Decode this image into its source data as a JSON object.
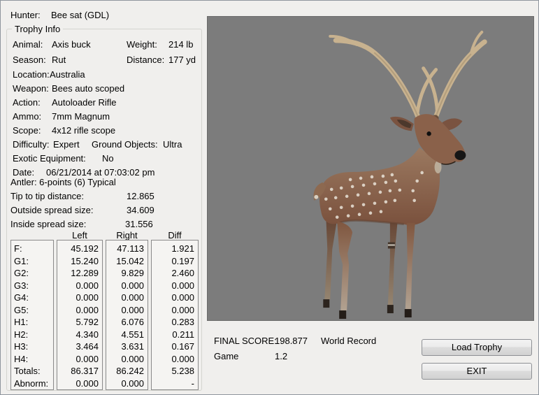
{
  "hunter": {
    "label": "Hunter:",
    "value": "Bee sat (GDL)"
  },
  "trophy_info": {
    "title": "Trophy Info",
    "animal": {
      "label": "Animal:",
      "value": "Axis buck"
    },
    "weight": {
      "label": "Weight:",
      "value": "214 lb"
    },
    "season": {
      "label": "Season:",
      "value": "Rut"
    },
    "distance": {
      "label": "Distance:",
      "value": "177 yd"
    },
    "location": {
      "label": "Location:",
      "value": "Australia"
    },
    "weapon": {
      "label": "Weapon:",
      "value": "Bees auto scoped"
    },
    "action": {
      "label": "Action:",
      "value": "Autoloader Rifle"
    },
    "ammo": {
      "label": "Ammo:",
      "value": "7mm Magnum"
    },
    "scope": {
      "label": "Scope:",
      "value": "4x12 rifle scope"
    },
    "difficulty": {
      "label": "Difficulty:",
      "value": "Expert"
    },
    "ground_objects": {
      "label": "Ground Objects:",
      "value": "Ultra"
    },
    "exotic_equipment": {
      "label": "Exotic Equipment:",
      "value": "No"
    },
    "date": {
      "label": "Date:",
      "value": "06/21/2014 at 07:03:02 pm"
    }
  },
  "antler": {
    "summary": "Antler: 6-points (6) Typical",
    "tip_to_tip": {
      "label": "Tip to tip distance:",
      "value": "12.865"
    },
    "outside_spread": {
      "label": "Outside spread size:",
      "value": "34.609"
    },
    "inside_spread": {
      "label": "Inside spread size:",
      "value": "31.556"
    }
  },
  "measurements": {
    "headers": {
      "left": "Left",
      "right": "Right",
      "diff": "Diff"
    },
    "rows": [
      {
        "label": "F:",
        "left": "45.192",
        "right": "47.113",
        "diff": "1.921"
      },
      {
        "label": "G1:",
        "left": "15.240",
        "right": "15.042",
        "diff": "0.197"
      },
      {
        "label": "G2:",
        "left": "12.289",
        "right": "9.829",
        "diff": "2.460"
      },
      {
        "label": "G3:",
        "left": "0.000",
        "right": "0.000",
        "diff": "0.000"
      },
      {
        "label": "G4:",
        "left": "0.000",
        "right": "0.000",
        "diff": "0.000"
      },
      {
        "label": "G5:",
        "left": "0.000",
        "right": "0.000",
        "diff": "0.000"
      },
      {
        "label": "H1:",
        "left": "5.792",
        "right": "6.076",
        "diff": "0.283"
      },
      {
        "label": "H2:",
        "left": "4.340",
        "right": "4.551",
        "diff": "0.211"
      },
      {
        "label": "H3:",
        "left": "3.464",
        "right": "3.631",
        "diff": "0.167"
      },
      {
        "label": "H4:",
        "left": "0.000",
        "right": "0.000",
        "diff": "0.000"
      },
      {
        "label": "Totals:",
        "left": "86.317",
        "right": "86.242",
        "diff": "5.238"
      },
      {
        "label": "Abnorm:",
        "left": "0.000",
        "right": "0.000",
        "diff": "-"
      }
    ]
  },
  "score": {
    "final_label": "FINAL SCORE:",
    "final_value": "198.877",
    "record": "World Record",
    "game_label": "Game",
    "game_value": "1.2"
  },
  "buttons": {
    "load_trophy": "Load Trophy",
    "exit": "EXIT"
  },
  "colors": {
    "window_bg": "#f0efed",
    "viewport_bg": "#7c7c7c",
    "antler": "#c8b28f",
    "deer_body": "#8a614a"
  }
}
